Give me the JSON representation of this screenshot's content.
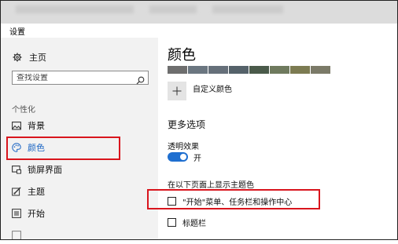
{
  "window": {
    "title": "设置"
  },
  "sidebar": {
    "home_label": "主页",
    "search_placeholder": "查找设置",
    "section_label": "个性化",
    "items": [
      {
        "label": "背景",
        "icon": "image-icon"
      },
      {
        "label": "颜色",
        "icon": "palette-icon",
        "active": true
      },
      {
        "label": "锁屏界面",
        "icon": "lock-screen-icon"
      },
      {
        "label": "主题",
        "icon": "theme-brush-icon"
      },
      {
        "label": "开始",
        "icon": "start-icon"
      }
    ]
  },
  "main": {
    "heading": "颜色",
    "swatches": [
      "#6e6e6e",
      "#6b7680",
      "#66707a",
      "#55626a",
      "#4a5a4a",
      "#6f7a5e",
      "#7c7b52",
      "#7b7a68"
    ],
    "custom_color_label": "自定义颜色",
    "more_options_heading": "更多选项",
    "transparency_label": "透明效果",
    "transparency_state": "开",
    "show_accent_label": "在以下页面上显示主题色",
    "checkboxes": [
      {
        "label": "\"开始\"菜单、任务栏和操作中心",
        "checked": false
      },
      {
        "label": "标题栏",
        "checked": false
      }
    ]
  },
  "colors": {
    "accent": "#1f6fd0",
    "highlight_box": "#d9151d",
    "sidebar_bg": "#f2f2f2"
  }
}
